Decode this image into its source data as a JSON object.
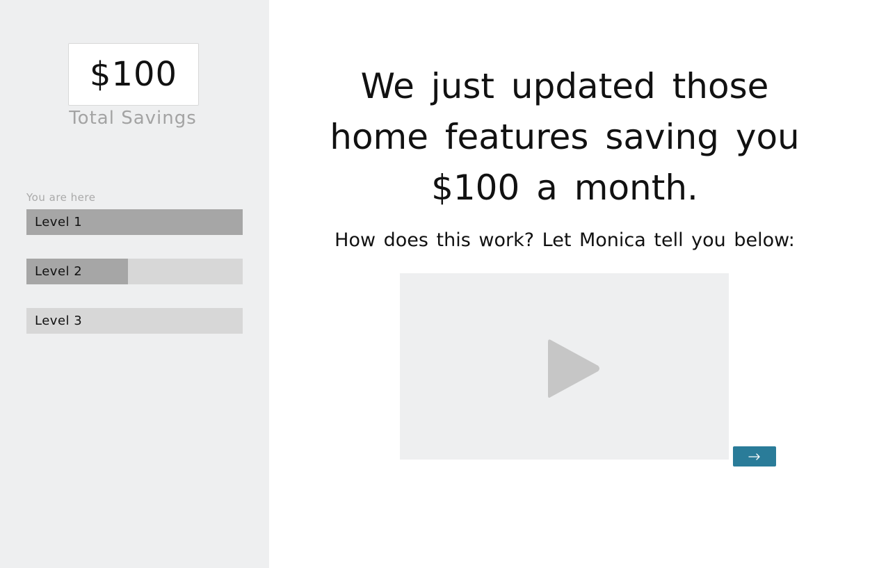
{
  "sidebar": {
    "savings_amount": "$100",
    "savings_label": "Total Savings",
    "progress_caption": "You are here",
    "levels": [
      {
        "label": "Level 1",
        "progress": 1.0
      },
      {
        "label": "Level 2",
        "progress": 0.47
      },
      {
        "label": "Level 3",
        "progress": 0.0
      }
    ]
  },
  "main": {
    "headline": "We just updated those home features saving you $100 a month.",
    "subheadline": "How does this work? Let Monica tell you below:",
    "video": {
      "icon": "play-icon"
    },
    "next_button": {
      "icon": "arrow-right-icon"
    }
  },
  "colors": {
    "sidebar_bg": "#eeeff0",
    "level_track": "#d7d7d7",
    "level_fill": "#a6a6a6",
    "accent": "#2a7c99"
  }
}
